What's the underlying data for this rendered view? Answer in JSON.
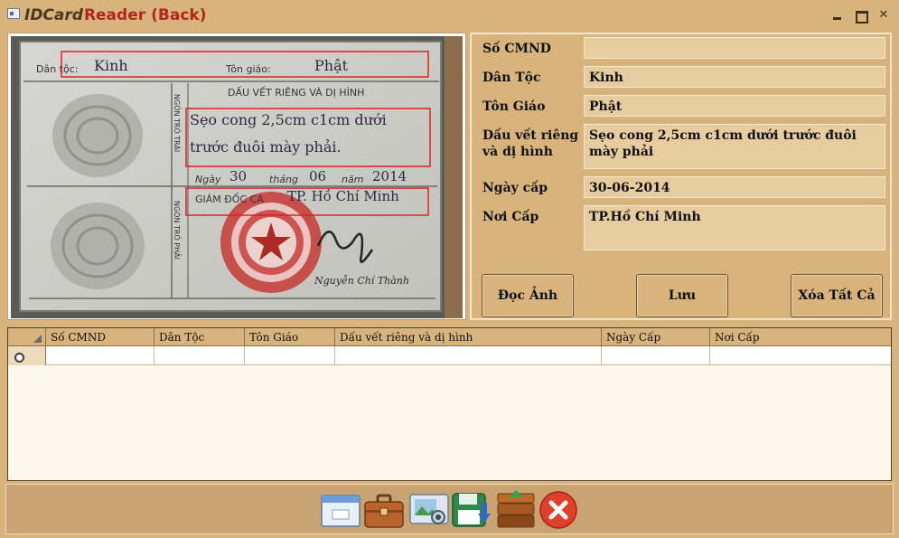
{
  "window": {
    "title_italic": "IDCard",
    "title_app": "Reader",
    "title_mode": "(Back)",
    "btn_close": "✕"
  },
  "card_image": {
    "dan_toc_label": "Dân tộc:",
    "dan_toc_value": "Kinh",
    "ton_giao_label": "Tôn giáo:",
    "ton_giao_value": "Phật",
    "dau_vet_heading": "DẤU VẾT RIÊNG VÀ DỊ HÌNH",
    "ngon_tro_trai": "NGÓN TRỎ TRÁI",
    "ngon_tro_phai": "NGÓN TRỎ PHẢI",
    "dau_vet_line1": "Sẹo cong 2,5cm c1cm dưới",
    "dau_vet_line2": "trước đuôi mày phải.",
    "ngay_label": "Ngày",
    "ngay_value": "30",
    "thang_label": "tháng",
    "thang_value": "06",
    "nam_label": "năm",
    "nam_value": "2014",
    "giam_doc_label": "GIÁM ĐỐC CA",
    "giam_doc_value": "TP. Hồ Chí Minh",
    "signature": "Nguyễn Chí Thành",
    "accent": "#e02020"
  },
  "form": {
    "so_cmnd_label": "Số CMND",
    "so_cmnd_value": "",
    "dan_toc_label": "Dân Tộc",
    "dan_toc_value": "Kinh",
    "ton_giao_label": "Tôn Giáo",
    "ton_giao_value": "Phật",
    "dau_vet_label_1": "Dấu vết riêng",
    "dau_vet_label_2": "và dị hình",
    "dau_vet_value": "Sẹo cong 2,5cm c1cm dưới trước đuôi mày phải",
    "ngay_cap_label": "Ngày cấp",
    "ngay_cap_value": "30-06-2014",
    "noi_cap_label": "Nơi Cấp",
    "noi_cap_value": "TP.Hồ Chí Minh",
    "btn_doc_anh": "Đọc Ảnh",
    "btn_luu": "Lưu",
    "btn_xoa": "Xóa Tất Cả"
  },
  "grid": {
    "columns": [
      "Số CMND",
      "Dân Tộc",
      "Tôn Giáo",
      "Dấu vết riêng và dị hình",
      "Ngày Cấp",
      "Nơi Cấp"
    ]
  },
  "toolbar": {
    "icons": [
      "window-icon",
      "briefcase-icon",
      "photo-card-icon",
      "save-disk-icon",
      "archive-box-icon",
      "exit-icon"
    ]
  }
}
